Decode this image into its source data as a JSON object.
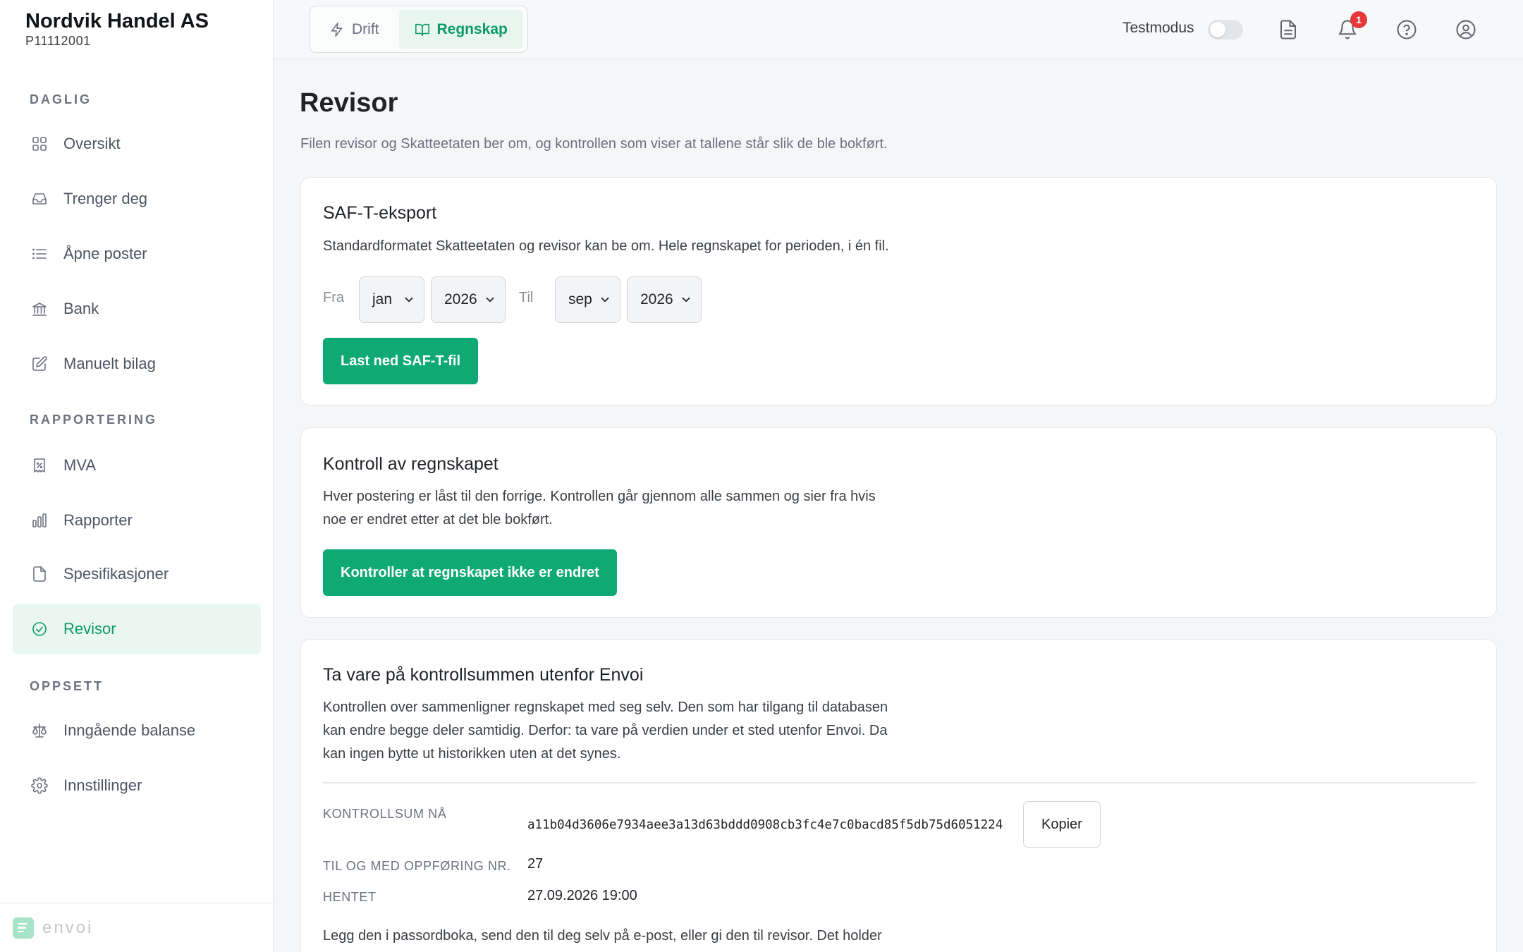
{
  "org": {
    "name": "Nordvik Handel AS",
    "id": "P11112001"
  },
  "sidebar": {
    "sections": [
      {
        "label": "DAGLIG"
      },
      {
        "label": "RAPPORTERING"
      },
      {
        "label": "OPPSETT"
      }
    ],
    "items": [
      {
        "label": "Oversikt",
        "icon": "grid-icon"
      },
      {
        "label": "Trenger deg",
        "icon": "inbox-icon"
      },
      {
        "label": "Åpne poster",
        "icon": "list-icon"
      },
      {
        "label": "Bank",
        "icon": "bank-icon"
      },
      {
        "label": "Manuelt bilag",
        "icon": "edit-icon"
      },
      {
        "label": "MVA",
        "icon": "receipt-percent-icon"
      },
      {
        "label": "Rapporter",
        "icon": "bar-chart-icon"
      },
      {
        "label": "Spesifikasjoner",
        "icon": "file-icon"
      },
      {
        "label": "Revisor",
        "icon": "check-circle-icon",
        "active": true
      },
      {
        "label": "Inngående balanse",
        "icon": "scale-icon"
      },
      {
        "label": "Innstillinger",
        "icon": "gear-icon"
      }
    ],
    "brand": "envoi"
  },
  "topbar": {
    "modes": [
      {
        "label": "Drift",
        "icon": "bolt-icon"
      },
      {
        "label": "Regnskap",
        "icon": "book-icon",
        "active": true
      }
    ],
    "testmodus_label": "Testmodus",
    "testmodus_on": false,
    "notification_count": "1",
    "icons": [
      "document-icon",
      "bell-icon",
      "help-icon",
      "user-icon"
    ]
  },
  "page": {
    "title": "Revisor",
    "subtitle": "Filen revisor og Skatteetaten ber om, og kontrollen som viser at tallene står slik de ble bokført."
  },
  "saft": {
    "title": "SAF-T-eksport",
    "description": "Standardformatet Skatteetaten og revisor kan be om. Hele regnskapet for perioden, i én fil.",
    "from_label": "Fra",
    "from_month": "jan",
    "from_year": "2026",
    "to_label": "Til",
    "to_month": "sep",
    "to_year": "2026",
    "button": "Last ned SAF-T-fil"
  },
  "control": {
    "title": "Kontroll av regnskapet",
    "line1": "Hver postering er låst til den forrige. Kontrollen går gjennom alle sammen og sier fra hvis",
    "line2": "noe er endret etter at det ble bokført.",
    "button": "Kontroller at regnskapet ikke er endret"
  },
  "checksum": {
    "title": "Ta vare på kontrollsummen utenfor Envoi",
    "line1": "Kontrollen over sammenligner regnskapet med seg selv. Den som har tilgang til databasen",
    "line2": "kan endre begge deler samtidig. Derfor: ta vare på verdien under et sted utenfor Envoi. Da",
    "line3": "kan ingen bytte ut historikken uten at det synes.",
    "sum_label": "KONTROLLSUM NÅ",
    "sum_value": "a11b04d3606e7934aee3a13d63bddd0908cb3fc4e7c0bacd85f5db75d6051224",
    "copy_button": "Kopier",
    "entry_label": "TIL OG MED OPPFØRING NR.",
    "entry_value": "27",
    "fetched_label": "HENTET",
    "fetched_value": "27.09.2026 19:00",
    "footer_line": "Legg den i passordboka, send den til deg selv på e-post, eller gi den til revisor. Det holder"
  }
}
